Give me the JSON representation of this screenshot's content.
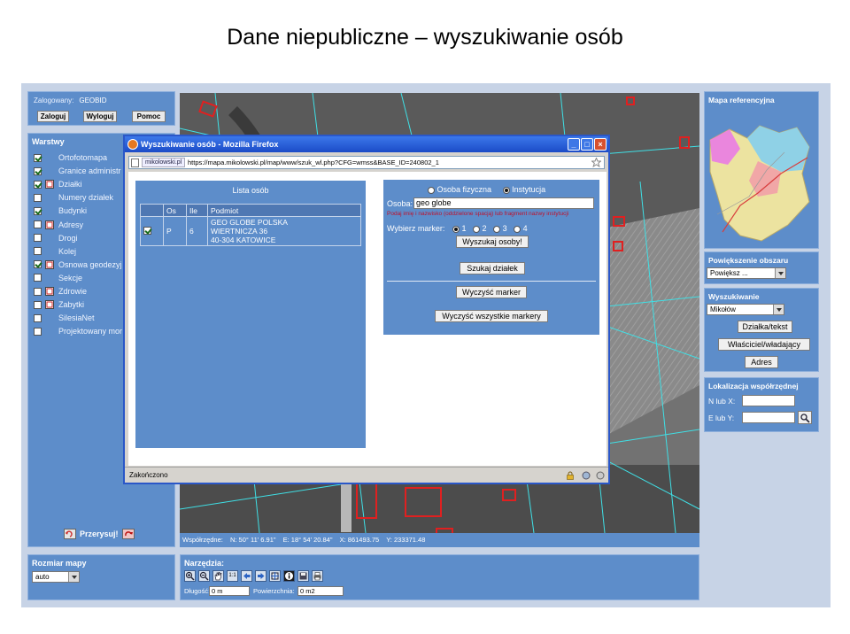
{
  "slide_title": "Dane niepubliczne – wyszukiwanie osób",
  "login": {
    "label": "Zalogowany:",
    "user": "GEOBID",
    "buttons": [
      "Zaloguj",
      "Wyloguj",
      "Pomoc"
    ]
  },
  "layers": {
    "title": "Warstwy",
    "items": [
      {
        "label": "Ortofotomapa",
        "checked": true,
        "icon": false
      },
      {
        "label": "Granice administr",
        "checked": true,
        "icon": false
      },
      {
        "label": "Działki",
        "checked": true,
        "icon": true
      },
      {
        "label": "Numery działek",
        "checked": false,
        "icon": false
      },
      {
        "label": "Budynki",
        "checked": true,
        "icon": false
      },
      {
        "label": "Adresy",
        "checked": false,
        "icon": true
      },
      {
        "label": "Drogi",
        "checked": false,
        "icon": false
      },
      {
        "label": "Kolej",
        "checked": false,
        "icon": false
      },
      {
        "label": "Osnowa geodezyj",
        "checked": true,
        "icon": true
      },
      {
        "label": "Sekcje",
        "checked": false,
        "icon": false
      },
      {
        "label": "Zdrowie",
        "checked": false,
        "icon": true
      },
      {
        "label": "Zabytki",
        "checked": false,
        "icon": true
      },
      {
        "label": "SilesiaNet",
        "checked": false,
        "icon": false
      },
      {
        "label": "Projektowany mor",
        "checked": false,
        "icon": false
      }
    ],
    "reload_label": "Przerysuj!"
  },
  "map_size": {
    "title": "Rozmiar mapy",
    "value": "auto"
  },
  "coords": {
    "label": "Współrzędne:",
    "n": "N: 50° 11' 6.91\"",
    "e": "E: 18° 54' 20.84\"",
    "x": "X: 861493.75",
    "y": "Y: 233371.48"
  },
  "tools": {
    "title": "Narzędzia:",
    "length_label": "Długość:",
    "length_value": "0 m",
    "area_label": "Powierzchnia:",
    "area_value": "0 m2",
    "scale_label": "1:1"
  },
  "right": {
    "ref_title": "Mapa referencyjna",
    "zoom_title": "Powiększenie obszaru",
    "zoom_value": "Powiększ ...",
    "search_title": "Wyszukiwanie",
    "search_value": "Mikołów",
    "btn_parcel": "Działka/tekst",
    "btn_owner": "Właściciel/władający",
    "btn_address": "Adres",
    "loc_title": "Lokalizacja współrzędnej",
    "n_label": "N lub X:",
    "e_label": "E lub Y:"
  },
  "popup": {
    "title": "Wyszukiwanie osób - Mozilla Firefox",
    "site": "mikolowski.pl",
    "url": "https://mapa.mikolowski.pl/map/www/szuk_wl.php?CFG=wmss&BASE_ID=240802_1",
    "status": "Zakończono",
    "list_title": "Lista osób",
    "table": {
      "headers": [
        "",
        "Os",
        "Ile",
        "Podmiot"
      ],
      "rows": [
        {
          "checked": true,
          "os": "P",
          "ile": "6",
          "podmiot": [
            "GEO GLOBE POLSKA",
            "WIERTNICZA 36",
            "40-304 KATOWICE"
          ]
        }
      ]
    },
    "search": {
      "radio_person": "Osoba fizyczna",
      "radio_inst": "Instytucja",
      "osoba_label": "Osoba:",
      "osoba_value": "geo globe",
      "hint": "Podaj imię i nazwisko (oddzielone spacją) lub fragment nazwy instytucji",
      "marker_label": "Wybierz marker:",
      "markers": [
        "1",
        "2",
        "3",
        "4"
      ],
      "btn_find": "Wyszukaj osoby!",
      "btn_parcels": "Szukaj działek",
      "btn_clear": "Wyczyść marker",
      "btn_clear_all": "Wyczyść wszystkie markery"
    }
  }
}
